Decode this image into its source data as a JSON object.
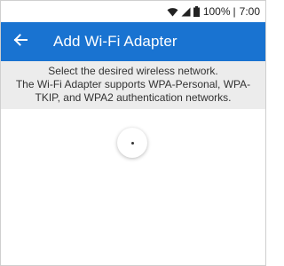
{
  "status_bar": {
    "battery": "100%",
    "time": "7:00",
    "icons": [
      "wifi-icon",
      "signal-icon",
      "battery-icon"
    ]
  },
  "app_bar": {
    "title": "Add Wi-Fi Adapter",
    "back_icon": "arrow-left-icon",
    "background_color": "#1973d1"
  },
  "info": {
    "line1": "Select the desired wireless network.",
    "line2": "The Wi-Fi Adapter supports WPA-Personal, WPA-TKIP, and WPA2 authentication networks."
  },
  "colors": {
    "accent": "#1973d1",
    "panel": "#ececec"
  }
}
